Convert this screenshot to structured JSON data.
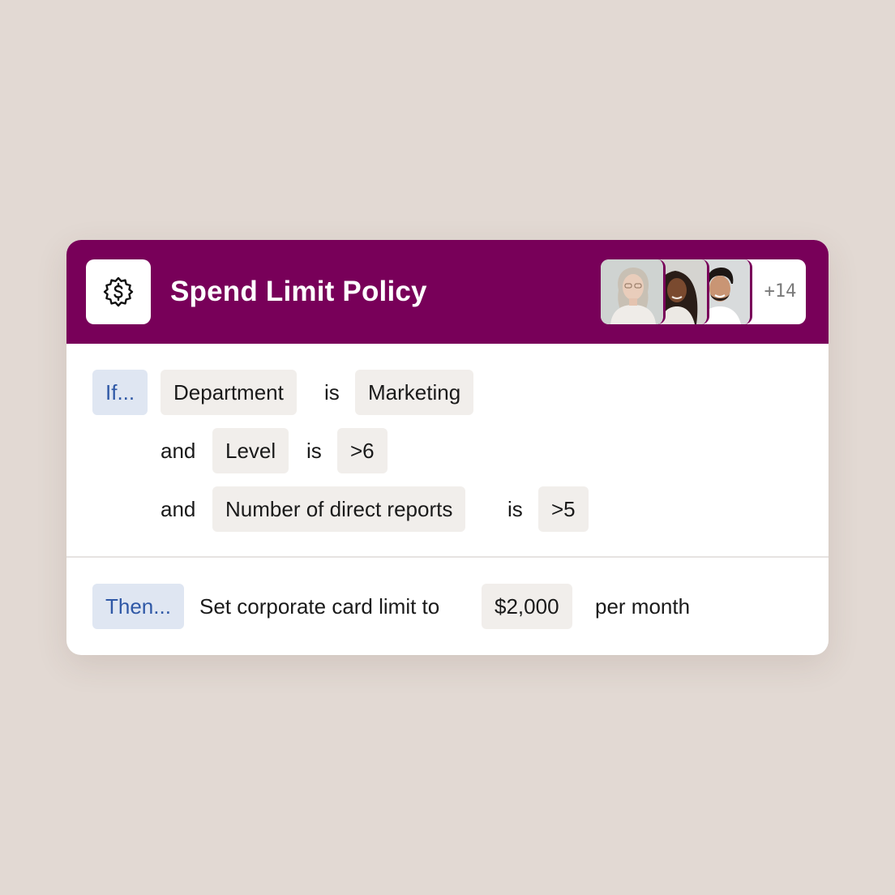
{
  "policy": {
    "title": "Spend Limit Policy",
    "icon": "gear-dollar-icon",
    "assignees_more": "+14",
    "brand_color": "#780059"
  },
  "conditions": {
    "if_label": "If...",
    "rows": [
      {
        "connector": "",
        "field": "Department",
        "operator": "is",
        "value": "Marketing"
      },
      {
        "connector": "and",
        "field": "Level",
        "operator": "is",
        "value": ">6"
      },
      {
        "connector": "and",
        "field": "Number of direct reports",
        "operator": "is",
        "value": ">5"
      }
    ]
  },
  "action": {
    "then_label": "Then...",
    "text": "Set corporate card limit to",
    "amount": "$2,000",
    "period": "per month"
  }
}
